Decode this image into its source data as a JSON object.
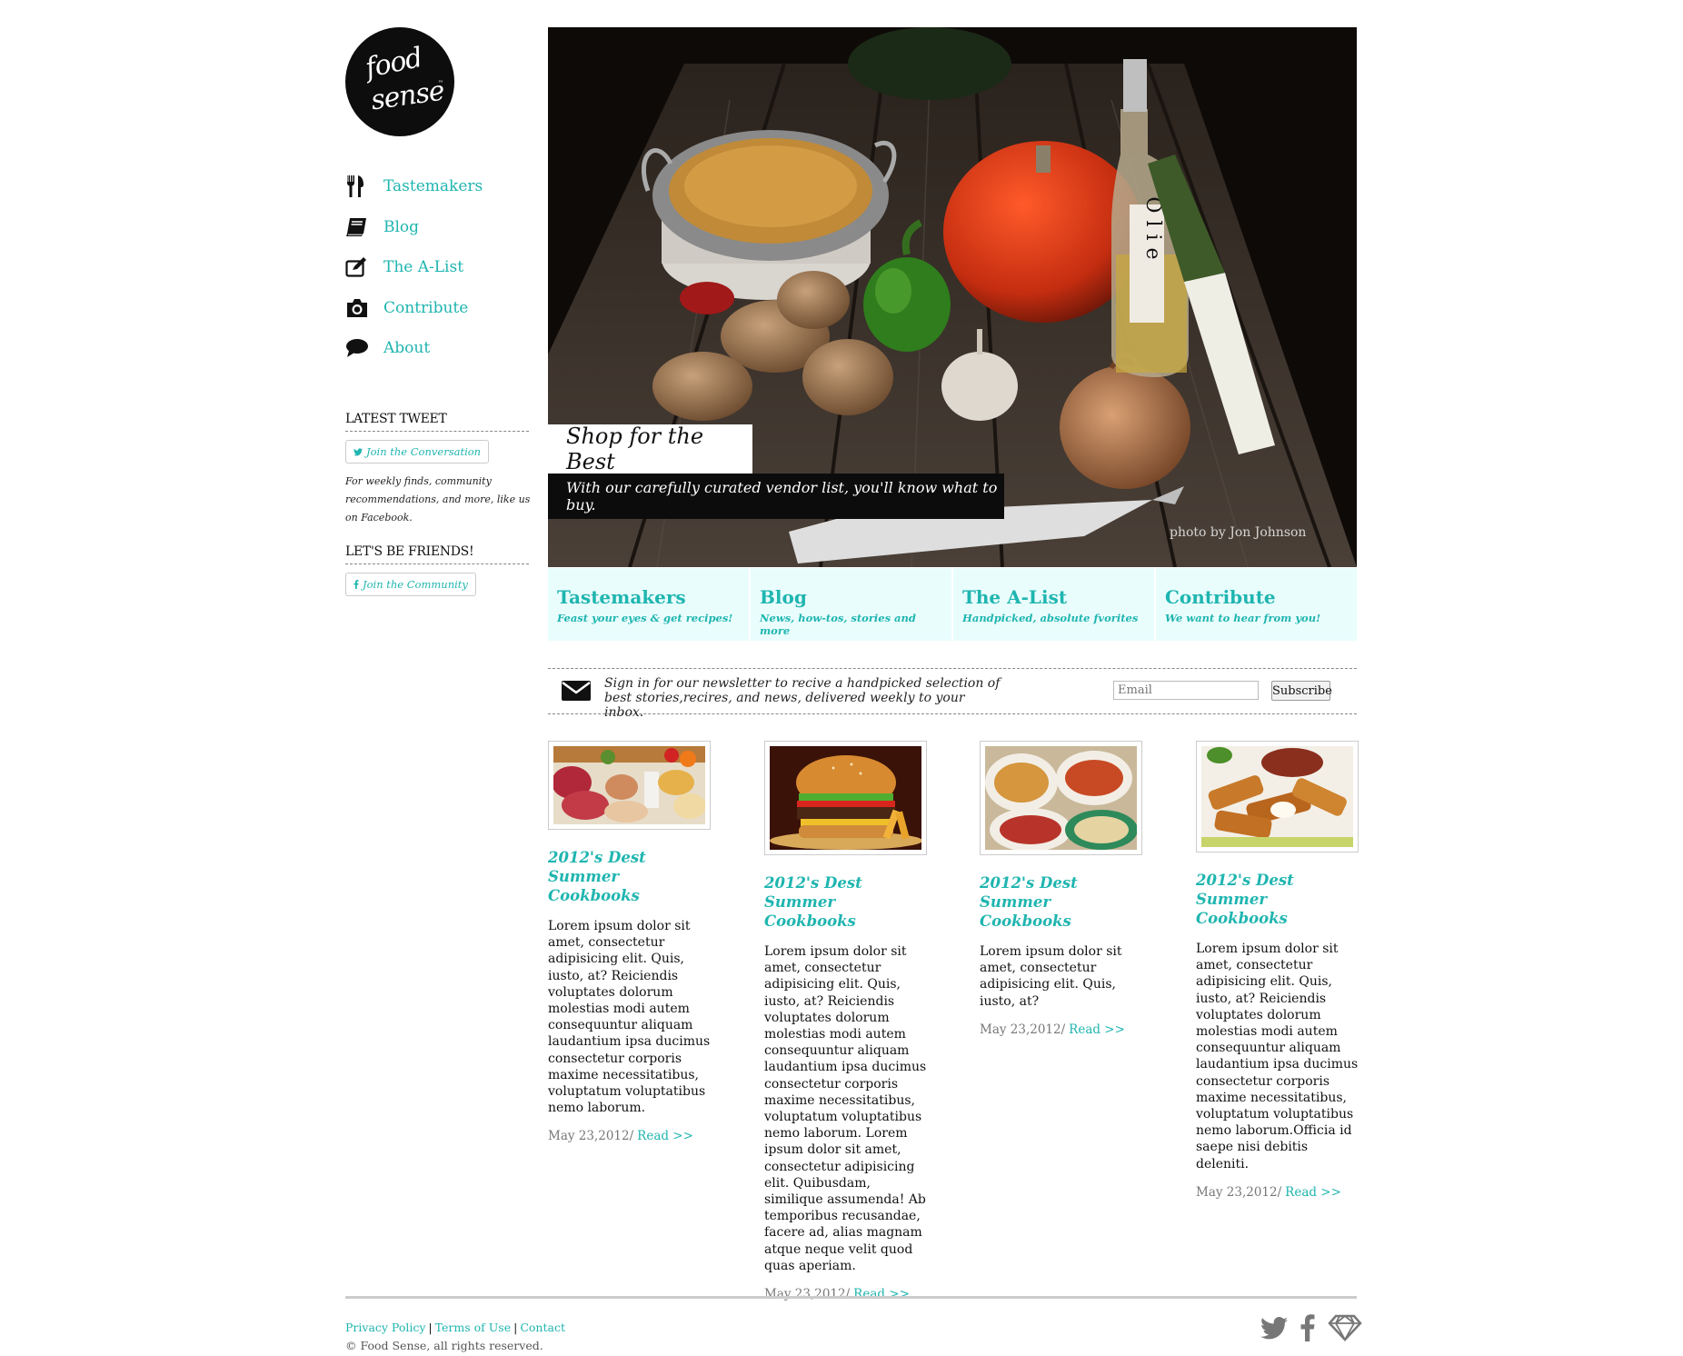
{
  "brand": {
    "logo_line1": "food",
    "logo_line2": "sense",
    "logo_tm": "™"
  },
  "nav": {
    "items": [
      {
        "label": "Tastemakers",
        "icon": "fork-knife-icon"
      },
      {
        "label": "Blog",
        "icon": "book-icon"
      },
      {
        "label": "The A-List",
        "icon": "edit-icon"
      },
      {
        "label": "Contribute",
        "icon": "camera-icon"
      },
      {
        "label": "About",
        "icon": "speech-bubble-icon"
      }
    ]
  },
  "sidebar": {
    "latest_tweet_heading": "LATEST TWEET",
    "tweet_button": "Join the Conversation",
    "tweet_text": "For weekly finds, community recommendations, and more, like us on Facebook.",
    "friends_heading": "LET'S BE FRIENDS!",
    "friends_button": "Join the Community"
  },
  "hero": {
    "caption_title": "Shop for the Best",
    "caption_subtitle": "With our carefully curated vendor list, you'll know what to buy.",
    "photo_credit": "photo by Jon Johnson",
    "bottle_label": "Olie"
  },
  "features": [
    {
      "title": "Tastemakers",
      "subtitle": "Feast your eyes & get recipes!"
    },
    {
      "title": "Blog",
      "subtitle": "News, how-tos, stories and more"
    },
    {
      "title": "The A-List",
      "subtitle": "Handpicked, absolute fvorites"
    },
    {
      "title": "Contribute",
      "subtitle": "We want to hear from you!"
    }
  ],
  "newsletter": {
    "text": "Sign in for our newsletter to recive a handpicked selection of best stories,recires, and news, delivered weekly to your inbox.",
    "email_placeholder": "Email",
    "subscribe_label": "Subscribe"
  },
  "posts": [
    {
      "title": "2012's Dest Summer Cookbooks",
      "body": "Lorem ipsum dolor sit amet, consectetur adipisicing elit. Quis, iusto, at? Reiciendis voluptates dolorum molestias modi autem consequuntur aliquam laudantium ipsa ducimus consectetur corporis maxime necessitatibus, voluptatum voluptatibus nemo laborum.",
      "date": "May 23,2012/",
      "read": "Read >>",
      "image": "groceries"
    },
    {
      "title": "2012's Dest Summer Cookbooks",
      "body": "Lorem ipsum dolor sit amet, consectetur adipisicing elit. Quis, iusto, at? Reiciendis voluptates dolorum molestias modi autem consequuntur aliquam laudantium ipsa ducimus consectetur corporis maxime necessitatibus, voluptatum voluptatibus nemo laborum. Lorem ipsum dolor sit amet, consectetur adipisicing elit. Quibusdam, similique assumenda! Ab temporibus recusandae, facere ad, alias magnam atque neque velit quod quas aperiam.",
      "date": "May 23,2012/",
      "read": "Read >>",
      "image": "burger"
    },
    {
      "title": "2012's Dest Summer Cookbooks",
      "body": "Lorem ipsum dolor sit amet, consectetur adipisicing elit. Quis, iusto, at?",
      "date": "May 23,2012/",
      "read": "Read >>",
      "image": "seafood-platter"
    },
    {
      "title": "2012's Dest Summer Cookbooks",
      "body": "Lorem ipsum dolor sit amet, consectetur adipisicing elit. Quis, iusto, at? Reiciendis voluptates dolorum molestias modi autem consequuntur aliquam laudantium ipsa ducimus consectetur corporis maxime necessitatibus, voluptatum voluptatibus nemo laborum.Officia id saepe nisi debitis deleniti.",
      "date": "May 23,2012/",
      "read": "Read >>",
      "image": "fried-sticks"
    }
  ],
  "footer": {
    "links": [
      "Privacy Policy",
      "Terms of Use",
      "Contact"
    ],
    "copyright": "© Food Sense, all rights reserved.",
    "social_icons": [
      "twitter-icon",
      "facebook-icon",
      "diamond-icon"
    ]
  },
  "colors": {
    "accent": "#1fb5b0",
    "feature_bg": "#e9fdfd",
    "dark": "#0d0d0d"
  }
}
